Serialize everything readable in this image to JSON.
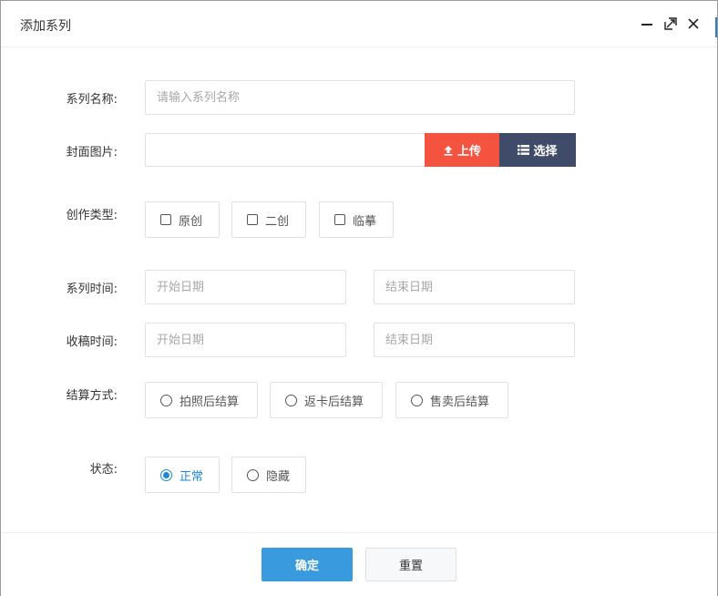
{
  "dialog": {
    "title": "添加系列",
    "minimize_icon": "minimize-icon",
    "maximize_icon": "maximize-icon",
    "close_icon": "close-icon"
  },
  "form": {
    "series_name": {
      "label": "系列名称:",
      "placeholder": "请输入系列名称",
      "value": ""
    },
    "cover_image": {
      "label": "封面图片:",
      "value": "",
      "upload_label": "上传",
      "upload_icon": "upload-icon",
      "select_label": "选择",
      "select_icon": "list-icon",
      "upload_color": "#f4533f",
      "select_color": "#404b6a"
    },
    "creation_type": {
      "label": "创作类型:",
      "options": [
        {
          "label": "原创",
          "checked": false
        },
        {
          "label": "二创",
          "checked": false
        },
        {
          "label": "临摹",
          "checked": false
        }
      ]
    },
    "series_time": {
      "label": "系列时间:",
      "start_placeholder": "开始日期",
      "end_placeholder": "结束日期"
    },
    "collect_time": {
      "label": "收稿时间:",
      "start_placeholder": "开始日期",
      "end_placeholder": "结束日期"
    },
    "settlement": {
      "label": "结算方式:",
      "options": [
        {
          "label": "拍照后结算",
          "selected": false
        },
        {
          "label": "返卡后结算",
          "selected": false
        },
        {
          "label": "售卖后结算",
          "selected": false
        }
      ]
    },
    "status": {
      "label": "状态:",
      "options": [
        {
          "label": "正常",
          "selected": true
        },
        {
          "label": "隐藏",
          "selected": false
        }
      ],
      "accent_color": "#1e88d8"
    }
  },
  "footer": {
    "confirm_label": "确定",
    "reset_label": "重置",
    "confirm_color": "#3a9ade"
  }
}
